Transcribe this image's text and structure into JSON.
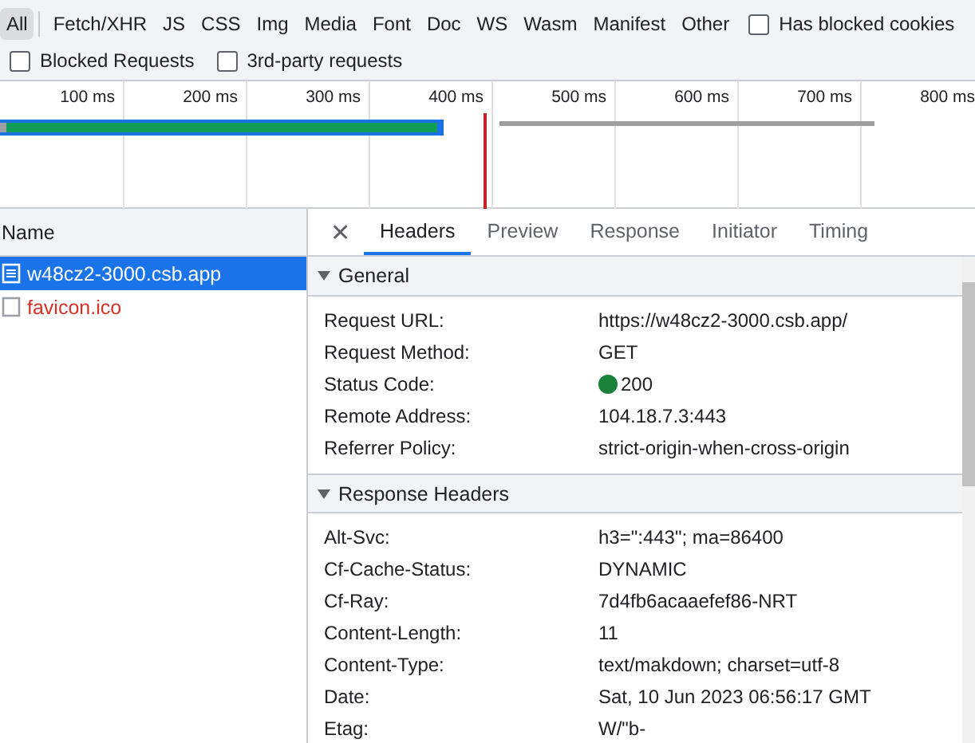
{
  "filters": [
    {
      "label": "All",
      "selected": true
    },
    {
      "label": "Fetch/XHR",
      "selected": false
    },
    {
      "label": "JS",
      "selected": false
    },
    {
      "label": "CSS",
      "selected": false
    },
    {
      "label": "Img",
      "selected": false
    },
    {
      "label": "Media",
      "selected": false
    },
    {
      "label": "Font",
      "selected": false
    },
    {
      "label": "Doc",
      "selected": false
    },
    {
      "label": "WS",
      "selected": false
    },
    {
      "label": "Wasm",
      "selected": false
    },
    {
      "label": "Manifest",
      "selected": false
    },
    {
      "label": "Other",
      "selected": false
    }
  ],
  "checkboxes": [
    {
      "label": "Has blocked cookies",
      "checked": false
    },
    {
      "label": "Blocked Requests",
      "checked": false
    },
    {
      "label": "3rd-party requests",
      "checked": false
    }
  ],
  "timeline": {
    "ticks": [
      "100 ms",
      "200 ms",
      "300 ms",
      "400 ms",
      "500 ms",
      "600 ms",
      "700 ms",
      "800 ms"
    ]
  },
  "requests": {
    "column": "Name",
    "rows": [
      {
        "name": "w48cz2-3000.csb.app",
        "kind": "document",
        "selected": true,
        "failed": false
      },
      {
        "name": "favicon.ico",
        "kind": "other",
        "selected": false,
        "failed": true
      }
    ]
  },
  "details": {
    "close": "✕",
    "tabs": [
      {
        "label": "Headers",
        "selected": true
      },
      {
        "label": "Preview",
        "selected": false
      },
      {
        "label": "Response",
        "selected": false
      },
      {
        "label": "Initiator",
        "selected": false
      },
      {
        "label": "Timing",
        "selected": false
      }
    ],
    "sections": [
      {
        "title": "General",
        "expanded": true,
        "rows": [
          {
            "key": "Request URL:",
            "value": "https://w48cz2-3000.csb.app/"
          },
          {
            "key": "Request Method:",
            "value": "GET"
          },
          {
            "key": "Status Code:",
            "value": "200",
            "color": "#188038"
          },
          {
            "key": "Remote Address:",
            "value": "104.18.7.3:443"
          },
          {
            "key": "Referrer Policy:",
            "value": "strict-origin-when-cross-origin"
          }
        ]
      },
      {
        "title": "Response Headers",
        "expanded": true,
        "rows": [
          {
            "key": "Alt-Svc:",
            "value": "h3=\":443\"; ma=86400"
          },
          {
            "key": "Cf-Cache-Status:",
            "value": "DYNAMIC"
          },
          {
            "key": "Cf-Ray:",
            "value": "7d4fb6acaaefef86-NRT"
          },
          {
            "key": "Content-Length:",
            "value": "11"
          },
          {
            "key": "Content-Type:",
            "value": "text/makdown; charset=utf-8"
          },
          {
            "key": "Date:",
            "value": "Sat, 10 Jun 2023 06:56:17 GMT"
          },
          {
            "key": "Etag:",
            "value": "W/\"b-"
          }
        ]
      }
    ]
  }
}
